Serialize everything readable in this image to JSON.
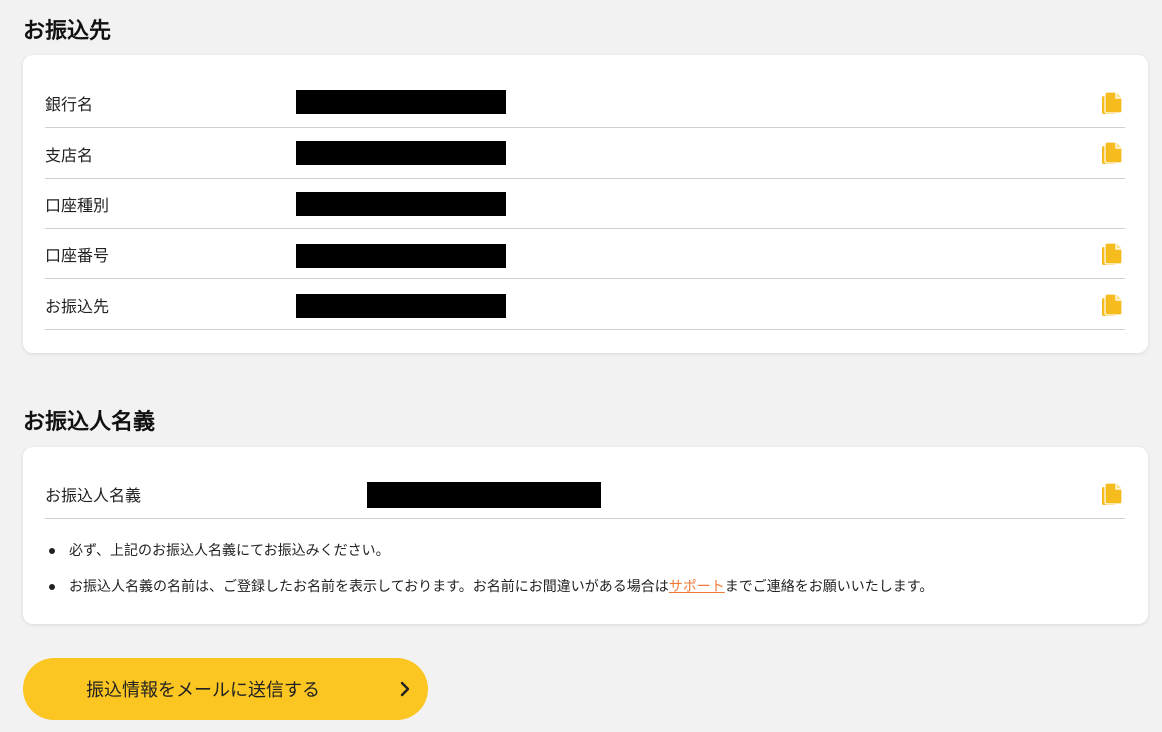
{
  "transfer_section": {
    "title": "お振込先",
    "rows": [
      {
        "label": "銀行名",
        "copyable": true
      },
      {
        "label": "支店名",
        "copyable": true
      },
      {
        "label": "口座種別",
        "copyable": false
      },
      {
        "label": "口座番号",
        "copyable": true
      },
      {
        "label": "お振込先",
        "copyable": true
      }
    ]
  },
  "payer_section": {
    "title": "お振込人名義",
    "row_label": "お振込人名義",
    "notes": [
      "必ず、上記のお振込人名義にてお振込みください。"
    ],
    "note2_before": "お振込人名義の名前は、ご登録したお名前を表示しております。お名前にお間違いがある場合は",
    "note2_link": "サポート",
    "note2_after": "までご連絡をお願いいたします。"
  },
  "mail_button": {
    "label": "振込情報をメールに送信する"
  },
  "colors": {
    "accent": "#fbc522",
    "icon": "#f6bb1c",
    "link": "#f07a3a",
    "redaction": "#000000"
  },
  "icons": {
    "copy": "copy-icon",
    "chevron": "chevron-right-icon"
  }
}
